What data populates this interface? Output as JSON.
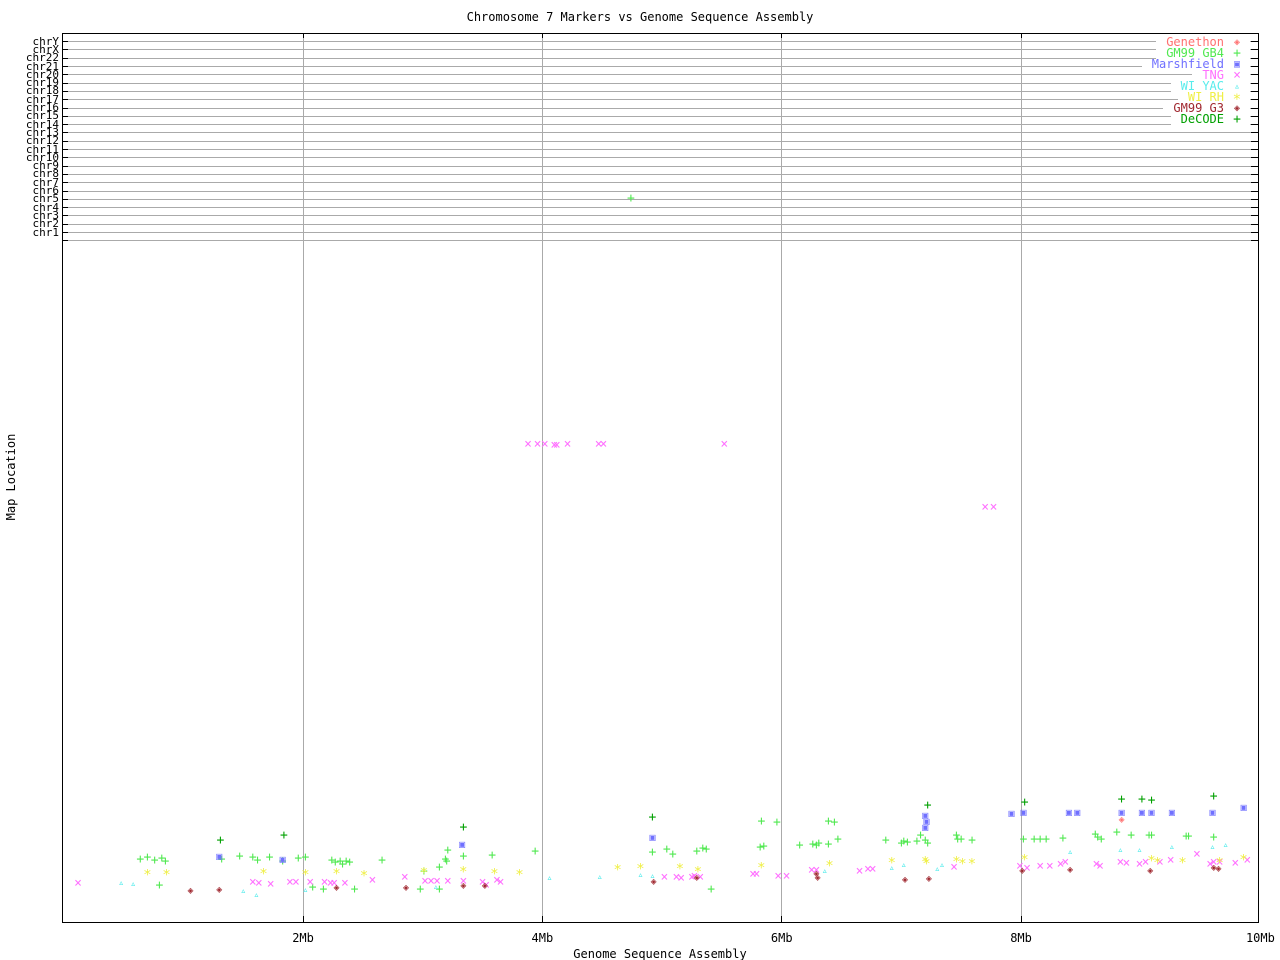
{
  "title": "Chromosome 7 Markers vs Genome Sequence Assembly",
  "x_axis": {
    "label": "Genome Sequence Assembly",
    "ticks": [
      {
        "label": "2Mb",
        "mb": 2
      },
      {
        "label": "4Mb",
        "mb": 4
      },
      {
        "label": "6Mb",
        "mb": 6
      },
      {
        "label": "8Mb",
        "mb": 8
      },
      {
        "label": "10Mb",
        "mb": 10
      }
    ],
    "range_mb": [
      0,
      10
    ]
  },
  "y_axis": {
    "label": "Map Location",
    "chromosomes": [
      "chrY",
      "chrX",
      "chr22",
      "chr21",
      "chr20",
      "chr19",
      "chr18",
      "chr17",
      "chr16",
      "chr15",
      "chr14",
      "chr13",
      "chr12",
      "chr11",
      "chr10",
      "chr9",
      "chr8",
      "chr7",
      "chr6",
      "chr5",
      "chr4",
      "chr3",
      "chr2",
      "chr1"
    ]
  },
  "colors": {
    "grid": "#aaaaaa",
    "axis": "#000000"
  },
  "chart_data": {
    "type": "scatter",
    "title": "Chromosome 7 Markers vs Genome Sequence Assembly",
    "xlabel": "Genome Sequence Assembly",
    "ylabel": "Map Location",
    "x_units": "Mb",
    "y_units": "screen px (no numeric map-location scale shown in image)",
    "xlim_mb": [
      0,
      10
    ],
    "legend_position": "top-right",
    "grid": true,
    "series": [
      {
        "name": "Genethon",
        "marker": "diamond",
        "color": "#ff7070",
        "points": [
          [
            8.84,
            821
          ]
        ]
      },
      {
        "name": "GM99 GB4",
        "marker": "plus",
        "color": "#50e850",
        "points": [
          [
            4.74,
            199
          ],
          [
            0.64,
            860
          ],
          [
            0.7,
            858
          ],
          [
            0.76,
            861
          ],
          [
            0.82,
            859
          ],
          [
            0.85,
            862
          ],
          [
            0.8,
            886
          ],
          [
            1.32,
            860
          ],
          [
            1.47,
            857
          ],
          [
            1.58,
            858
          ],
          [
            1.62,
            861
          ],
          [
            1.72,
            858
          ],
          [
            1.83,
            862
          ],
          [
            1.96,
            859
          ],
          [
            2.02,
            858
          ],
          [
            2.08,
            888
          ],
          [
            2.17,
            890
          ],
          [
            2.43,
            890
          ],
          [
            2.24,
            861
          ],
          [
            2.27,
            863
          ],
          [
            2.31,
            862
          ],
          [
            2.33,
            865
          ],
          [
            2.36,
            862
          ],
          [
            2.39,
            863
          ],
          [
            2.66,
            861
          ],
          [
            2.98,
            890
          ],
          [
            3.14,
            890
          ],
          [
            3.01,
            872
          ],
          [
            3.14,
            868
          ],
          [
            3.19,
            860
          ],
          [
            3.2,
            862
          ],
          [
            3.21,
            851
          ],
          [
            3.34,
            857
          ],
          [
            3.58,
            856
          ],
          [
            3.94,
            852
          ],
          [
            4.92,
            853
          ],
          [
            5.04,
            850
          ],
          [
            5.09,
            855
          ],
          [
            5.29,
            852
          ],
          [
            5.34,
            849
          ],
          [
            5.37,
            850
          ],
          [
            5.82,
            848
          ],
          [
            5.85,
            847
          ],
          [
            5.41,
            890
          ],
          [
            5.83,
            822
          ],
          [
            5.96,
            823
          ],
          [
            6.39,
            822
          ],
          [
            6.44,
            823
          ],
          [
            6.15,
            846
          ],
          [
            6.26,
            845
          ],
          [
            6.29,
            846
          ],
          [
            6.31,
            844
          ],
          [
            6.39,
            845
          ],
          [
            6.47,
            840
          ],
          [
            6.87,
            841
          ],
          [
            7.0,
            844
          ],
          [
            7.02,
            842
          ],
          [
            7.05,
            843
          ],
          [
            7.13,
            842
          ],
          [
            7.16,
            836
          ],
          [
            7.2,
            841
          ],
          [
            7.22,
            844
          ],
          [
            7.46,
            836
          ],
          [
            7.47,
            840
          ],
          [
            7.5,
            840
          ],
          [
            7.59,
            841
          ],
          [
            8.02,
            840
          ],
          [
            8.11,
            840
          ],
          [
            8.16,
            840
          ],
          [
            8.21,
            840
          ],
          [
            8.35,
            839
          ],
          [
            8.62,
            835
          ],
          [
            8.64,
            838
          ],
          [
            8.67,
            840
          ],
          [
            8.8,
            833
          ],
          [
            8.92,
            836
          ],
          [
            9.07,
            836
          ],
          [
            9.09,
            836
          ],
          [
            9.38,
            837
          ],
          [
            9.4,
            837
          ],
          [
            9.61,
            838
          ]
        ]
      },
      {
        "name": "Marshfield",
        "marker": "square",
        "color": "#7070ff",
        "points": [
          [
            1.3,
            858
          ],
          [
            1.83,
            861
          ],
          [
            3.33,
            846
          ],
          [
            4.92,
            839
          ],
          [
            7.2,
            817
          ],
          [
            7.21,
            823
          ],
          [
            7.2,
            829
          ],
          [
            7.92,
            815
          ],
          [
            8.02,
            814
          ],
          [
            8.4,
            814
          ],
          [
            8.47,
            814
          ],
          [
            8.84,
            814
          ],
          [
            9.01,
            814
          ],
          [
            9.09,
            814
          ],
          [
            9.26,
            814
          ],
          [
            9.6,
            814
          ],
          [
            9.86,
            809
          ]
        ]
      },
      {
        "name": "TNG",
        "marker": "cross",
        "color": "#ff70ff",
        "points": [
          [
            3.88,
            445
          ],
          [
            3.96,
            445
          ],
          [
            4.02,
            445
          ],
          [
            4.1,
            446
          ],
          [
            4.12,
            446
          ],
          [
            4.21,
            445
          ],
          [
            4.47,
            445
          ],
          [
            4.51,
            445
          ],
          [
            5.52,
            445
          ],
          [
            7.7,
            508
          ],
          [
            7.77,
            508
          ],
          [
            0.12,
            884
          ],
          [
            1.58,
            883
          ],
          [
            1.63,
            884
          ],
          [
            1.73,
            885
          ],
          [
            1.89,
            883
          ],
          [
            1.94,
            883
          ],
          [
            2.06,
            883
          ],
          [
            2.18,
            883
          ],
          [
            2.23,
            884
          ],
          [
            2.26,
            884
          ],
          [
            2.35,
            884
          ],
          [
            2.58,
            881
          ],
          [
            2.85,
            878
          ],
          [
            3.02,
            882
          ],
          [
            3.07,
            882
          ],
          [
            3.12,
            882
          ],
          [
            3.21,
            882
          ],
          [
            3.34,
            882
          ],
          [
            3.5,
            883
          ],
          [
            3.53,
            886
          ],
          [
            3.62,
            881
          ],
          [
            3.65,
            883
          ],
          [
            5.02,
            878
          ],
          [
            5.12,
            878
          ],
          [
            5.16,
            879
          ],
          [
            5.25,
            878
          ],
          [
            5.27,
            877
          ],
          [
            5.32,
            878
          ],
          [
            5.76,
            875
          ],
          [
            5.79,
            875
          ],
          [
            5.97,
            877
          ],
          [
            6.04,
            877
          ],
          [
            6.25,
            871
          ],
          [
            6.29,
            871
          ],
          [
            6.65,
            872
          ],
          [
            6.72,
            870
          ],
          [
            6.76,
            870
          ],
          [
            7.44,
            868
          ],
          [
            7.99,
            867
          ],
          [
            8.05,
            869
          ],
          [
            8.16,
            867
          ],
          [
            8.24,
            867
          ],
          [
            8.33,
            865
          ],
          [
            8.37,
            863
          ],
          [
            8.63,
            865
          ],
          [
            8.66,
            867
          ],
          [
            8.83,
            863
          ],
          [
            8.88,
            864
          ],
          [
            8.99,
            865
          ],
          [
            9.04,
            863
          ],
          [
            9.16,
            863
          ],
          [
            9.25,
            861
          ],
          [
            9.47,
            855
          ],
          [
            9.58,
            865
          ],
          [
            9.61,
            863
          ],
          [
            9.66,
            863
          ],
          [
            9.79,
            864
          ],
          [
            9.89,
            861
          ]
        ]
      },
      {
        "name": "WI YAC",
        "marker": "triangle",
        "color": "#58ecec",
        "points": [
          [
            0.48,
            884
          ],
          [
            0.58,
            885
          ],
          [
            1.5,
            892
          ],
          [
            1.61,
            896
          ],
          [
            2.02,
            891
          ],
          [
            3.11,
            888
          ],
          [
            4.06,
            879
          ],
          [
            4.48,
            878
          ],
          [
            4.82,
            876
          ],
          [
            4.92,
            877
          ],
          [
            6.36,
            872
          ],
          [
            6.92,
            869
          ],
          [
            7.02,
            866
          ],
          [
            7.3,
            870
          ],
          [
            7.34,
            866
          ],
          [
            8.41,
            853
          ],
          [
            8.83,
            851
          ],
          [
            8.99,
            851
          ],
          [
            9.26,
            848
          ],
          [
            9.6,
            848
          ],
          [
            9.71,
            846
          ]
        ]
      },
      {
        "name": "WI RH",
        "marker": "asterisk",
        "color": "#efef45",
        "points": [
          [
            0.7,
            873
          ],
          [
            0.86,
            873
          ],
          [
            1.67,
            872
          ],
          [
            2.02,
            873
          ],
          [
            2.28,
            872
          ],
          [
            2.51,
            874
          ],
          [
            3.01,
            871
          ],
          [
            3.34,
            870
          ],
          [
            3.6,
            872
          ],
          [
            3.81,
            873
          ],
          [
            4.63,
            868
          ],
          [
            4.82,
            867
          ],
          [
            5.15,
            867
          ],
          [
            5.3,
            870
          ],
          [
            5.83,
            866
          ],
          [
            6.4,
            864
          ],
          [
            6.92,
            861
          ],
          [
            7.2,
            860
          ],
          [
            7.21,
            862
          ],
          [
            7.46,
            860
          ],
          [
            7.51,
            862
          ],
          [
            7.59,
            862
          ],
          [
            8.03,
            858
          ],
          [
            9.09,
            859
          ],
          [
            9.14,
            861
          ],
          [
            9.35,
            861
          ],
          [
            9.66,
            861
          ],
          [
            9.86,
            858
          ]
        ]
      },
      {
        "name": "GM99 G3",
        "marker": "diamond",
        "color": "#a02830",
        "points": [
          [
            1.06,
            892
          ],
          [
            1.3,
            891
          ],
          [
            2.28,
            889
          ],
          [
            2.86,
            889
          ],
          [
            3.34,
            887
          ],
          [
            3.52,
            887
          ],
          [
            4.93,
            883
          ],
          [
            5.29,
            879
          ],
          [
            6.29,
            875
          ],
          [
            6.3,
            879
          ],
          [
            7.03,
            881
          ],
          [
            7.23,
            880
          ],
          [
            8.01,
            872
          ],
          [
            8.41,
            871
          ],
          [
            9.08,
            872
          ],
          [
            9.61,
            869
          ],
          [
            9.65,
            870
          ]
        ]
      },
      {
        "name": "DeCODE",
        "marker": "plus",
        "color": "#00a000",
        "points": [
          [
            1.31,
            841
          ],
          [
            1.84,
            836
          ],
          [
            3.34,
            828
          ],
          [
            4.92,
            818
          ],
          [
            7.22,
            806
          ],
          [
            8.03,
            803
          ],
          [
            8.84,
            800
          ],
          [
            9.01,
            800
          ],
          [
            9.09,
            801
          ],
          [
            9.61,
            797
          ]
        ]
      }
    ]
  }
}
